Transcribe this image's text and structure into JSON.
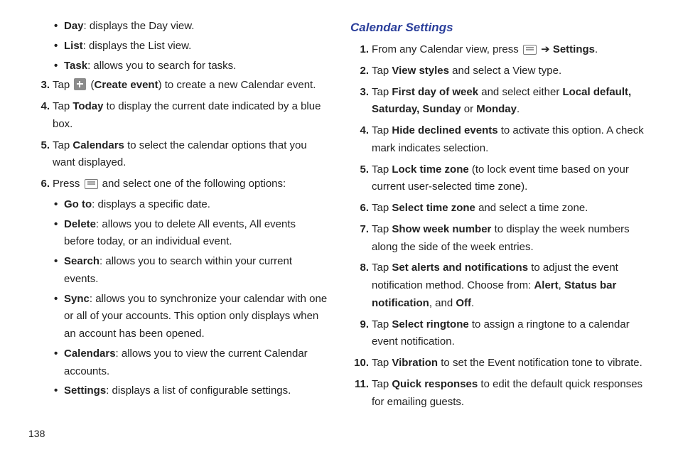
{
  "page_number": "138",
  "left": {
    "bullets": [
      {
        "lead": "Day",
        "rest": ": displays the Day view."
      },
      {
        "lead": "List",
        "rest": ": displays the List view."
      },
      {
        "lead": "Task",
        "rest": ": allows you to search for tasks."
      }
    ],
    "items3": {
      "pre": "Tap ",
      "icon_name": "plus-icon",
      "mid": " (",
      "bold": "Create event",
      "post": ") to create a new Calendar event."
    },
    "items4": {
      "pre": "Tap ",
      "bold": "Today",
      "post": " to display the current date indicated by a blue box."
    },
    "items5": {
      "pre": "Tap ",
      "bold": "Calendars",
      "post": " to select the calendar options that you want displayed."
    },
    "items6": {
      "pre": "Press ",
      "post": " and select one of the following options:"
    },
    "sub_bullets": [
      {
        "lead": "Go to",
        "rest": ": displays a specific date."
      },
      {
        "lead": "Delete",
        "rest": ": allows you to delete All events, All events before today, or an individual event."
      },
      {
        "lead": "Search",
        "rest": ": allows you to search within your current events."
      },
      {
        "lead": "Sync",
        "rest": ": allows you to synchronize your calendar with one or all of your accounts. This option only displays when an account has been opened."
      },
      {
        "lead": "Calendars",
        "rest": ": allows you to view the current Calendar accounts."
      },
      {
        "lead": "Settings",
        "rest": ": displays a list of configurable settings."
      }
    ]
  },
  "right": {
    "heading": "Calendar Settings",
    "arrow": " ➔ ",
    "items": [
      {
        "n": "1.",
        "pre": "From any Calendar view, press ",
        "bold2": "Settings",
        "post": "."
      },
      {
        "n": "2.",
        "pre": "Tap ",
        "bold": "View styles",
        "post": " and select a View type."
      },
      {
        "n": "3.",
        "pre": "Tap ",
        "bold": "First day of week",
        "mid": " and select either ",
        "bold2": "Local default, Saturday, Sunday",
        "mid2": " or ",
        "bold3": "Monday",
        "post": "."
      },
      {
        "n": "4.",
        "pre": "Tap ",
        "bold": "Hide declined events",
        "post": " to activate this option. A check mark indicates selection."
      },
      {
        "n": "5.",
        "pre": "Tap ",
        "bold": "Lock time zone",
        "post": " (to lock event time based on your current user-selected time zone)."
      },
      {
        "n": "6.",
        "pre": "Tap ",
        "bold": "Select time zone",
        "post": " and select a time zone."
      },
      {
        "n": "7.",
        "pre": "Tap ",
        "bold": "Show week number",
        "post": " to display the week numbers along the side of the week entries."
      },
      {
        "n": "8.",
        "pre": "Tap ",
        "bold": "Set alerts and notifications",
        "mid": " to adjust the event notification method. Choose from: ",
        "bold2": "Alert",
        "mid2": ", ",
        "bold3": "Status bar notification",
        "mid3": ", and ",
        "bold4": "Off",
        "post": "."
      },
      {
        "n": "9.",
        "pre": "Tap ",
        "bold": "Select ringtone",
        "post": " to assign a ringtone to a calendar event notification."
      },
      {
        "n": "10.",
        "pre": "Tap ",
        "bold": "Vibration",
        "post": " to set the Event notification tone to vibrate."
      },
      {
        "n": "11.",
        "pre": "Tap ",
        "bold": "Quick responses",
        "post": " to edit the default quick responses for emailing guests."
      }
    ]
  }
}
